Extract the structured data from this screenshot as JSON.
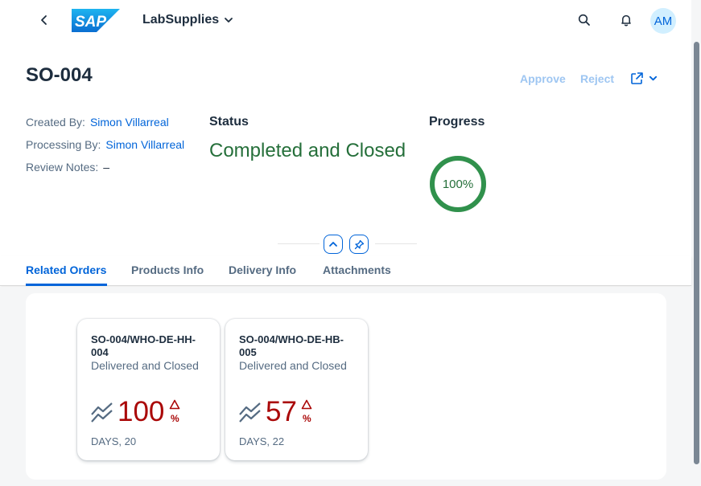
{
  "shell": {
    "app_title": "LabSupplies",
    "avatar_initials": "AM",
    "logo_text": "SAP"
  },
  "header": {
    "title": "SO-004",
    "actions": {
      "approve": "Approve",
      "reject": "Reject"
    },
    "attributes": {
      "created_by_label": "Created By:",
      "created_by_value": "Simon Villarreal",
      "processing_by_label": "Processing By:",
      "processing_by_value": "Simon Villarreal",
      "review_notes_label": "Review Notes:",
      "review_notes_value": "–"
    },
    "status": {
      "label": "Status",
      "value": "Completed and Closed",
      "color": "#256f3a"
    },
    "progress": {
      "label": "Progress",
      "value_text": "100%",
      "percent": 100
    }
  },
  "tabs": [
    {
      "label": "Related Orders",
      "active": true
    },
    {
      "label": "Products Info",
      "active": false
    },
    {
      "label": "Delivery Info",
      "active": false
    },
    {
      "label": "Attachments",
      "active": false
    }
  ],
  "cards": [
    {
      "title": "SO-004/WHO-DE-HH-004",
      "subtitle": "Delivered and Closed",
      "kpi_value": "100",
      "kpi_unit": "%",
      "footer": "DAYS, 20"
    },
    {
      "title": "SO-004/WHO-DE-HB-005",
      "subtitle": "Delivered and Closed",
      "kpi_value": "57",
      "kpi_unit": "%",
      "footer": "DAYS, 22"
    }
  ],
  "colors": {
    "accent": "#0064d9",
    "kpi_negative": "#aa0808",
    "positive": "#256f3a"
  }
}
